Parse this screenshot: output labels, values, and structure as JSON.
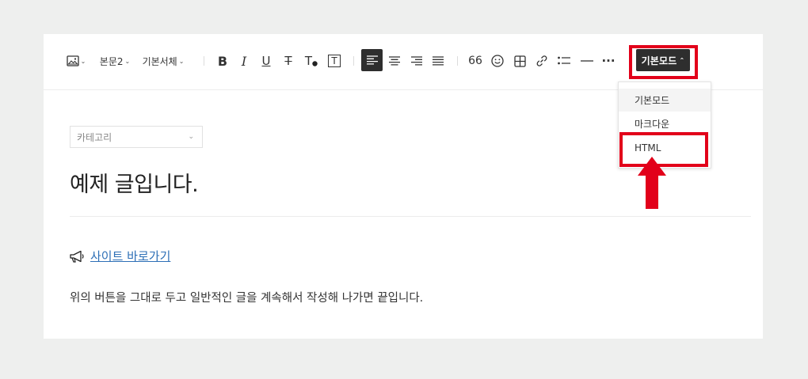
{
  "toolbar": {
    "image_icon": "image-icon",
    "paragraph_style": "본문2",
    "font_family": "기본서체",
    "bold_label": "B",
    "italic_label": "I",
    "underline_label": "U",
    "strike_label": "T",
    "text_color_label": "T",
    "text_bg_label": "T",
    "quote_label": "66",
    "more_label": "···",
    "mode_button_label": "기본모드"
  },
  "mode_menu": {
    "items": [
      {
        "label": "기본모드",
        "selected": true
      },
      {
        "label": "마크다운",
        "selected": false
      },
      {
        "label": "HTML",
        "selected": false
      }
    ]
  },
  "editor": {
    "category_placeholder": "카테고리",
    "title": "예제 글입니다.",
    "link_icon": "megaphone-icon",
    "link_text": "사이트 바로가기",
    "body": "위의 버튼을 그대로 두고 일반적인 글을 계속해서 작성해 나가면 끝입니다."
  },
  "colors": {
    "highlight_red": "#e2001a",
    "mode_button_bg": "#2e2e2e",
    "link_blue": "#2d6fb6",
    "page_bg": "#eeefee"
  }
}
